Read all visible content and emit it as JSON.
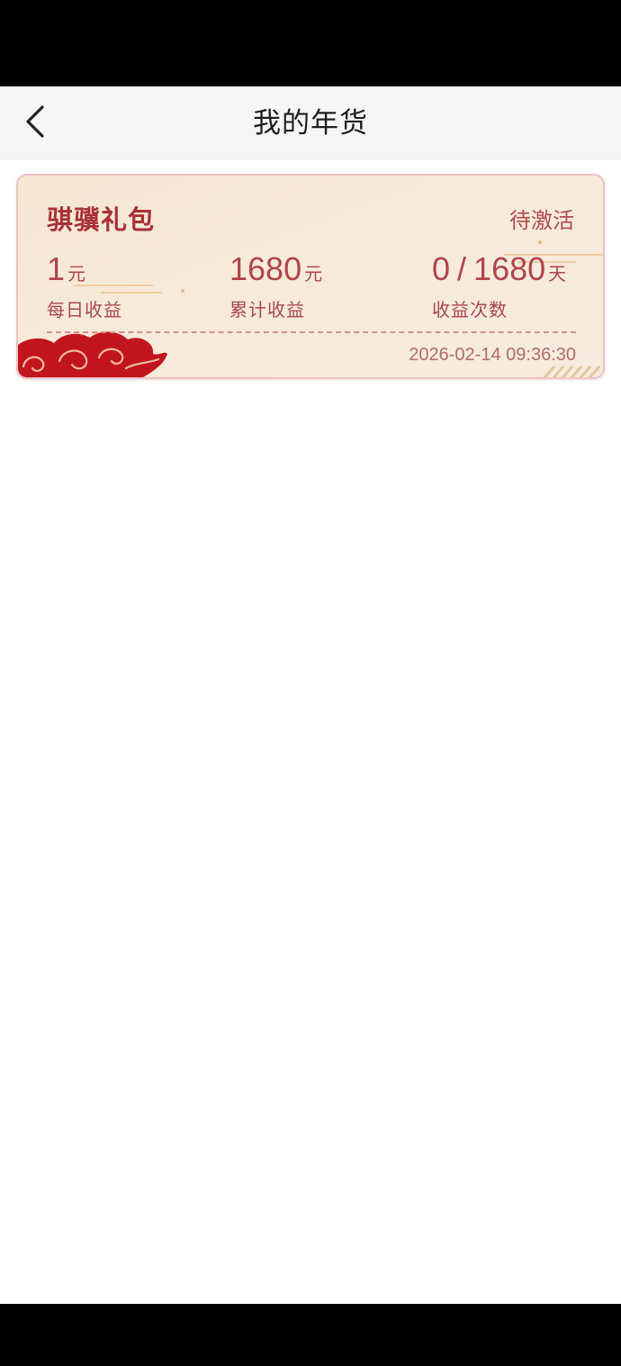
{
  "header": {
    "title": "我的年货"
  },
  "card": {
    "title": "骐骥礼包",
    "status": "待激活",
    "stats": [
      {
        "value": "1",
        "unit": "元",
        "label": "每日收益"
      },
      {
        "value": "1680",
        "unit": "元",
        "label": "累计收益"
      },
      {
        "current": "0",
        "separator": "/",
        "value": "1680",
        "unit": "天",
        "label": "收益次数"
      }
    ],
    "timestamp": "2026-02-14 09:36:30"
  },
  "colors": {
    "accent_red": "#a8313a",
    "card_background": "#f6e6d2",
    "cloud_red": "#c3151d"
  },
  "icons": {
    "back": "chevron-left-icon"
  }
}
